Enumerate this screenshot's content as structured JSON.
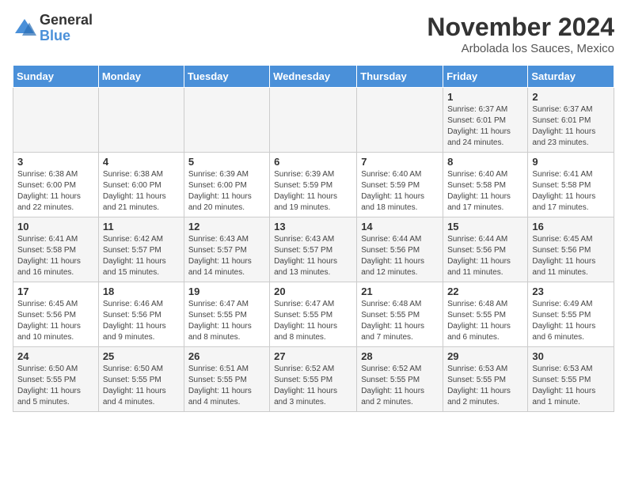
{
  "header": {
    "logo_general": "General",
    "logo_blue": "Blue",
    "month_title": "November 2024",
    "location": "Arbolada los Sauces, Mexico"
  },
  "calendar": {
    "days_of_week": [
      "Sunday",
      "Monday",
      "Tuesday",
      "Wednesday",
      "Thursday",
      "Friday",
      "Saturday"
    ],
    "weeks": [
      [
        {
          "day": "",
          "info": ""
        },
        {
          "day": "",
          "info": ""
        },
        {
          "day": "",
          "info": ""
        },
        {
          "day": "",
          "info": ""
        },
        {
          "day": "",
          "info": ""
        },
        {
          "day": "1",
          "info": "Sunrise: 6:37 AM\nSunset: 6:01 PM\nDaylight: 11 hours and 24 minutes."
        },
        {
          "day": "2",
          "info": "Sunrise: 6:37 AM\nSunset: 6:01 PM\nDaylight: 11 hours and 23 minutes."
        }
      ],
      [
        {
          "day": "3",
          "info": "Sunrise: 6:38 AM\nSunset: 6:00 PM\nDaylight: 11 hours and 22 minutes."
        },
        {
          "day": "4",
          "info": "Sunrise: 6:38 AM\nSunset: 6:00 PM\nDaylight: 11 hours and 21 minutes."
        },
        {
          "day": "5",
          "info": "Sunrise: 6:39 AM\nSunset: 6:00 PM\nDaylight: 11 hours and 20 minutes."
        },
        {
          "day": "6",
          "info": "Sunrise: 6:39 AM\nSunset: 5:59 PM\nDaylight: 11 hours and 19 minutes."
        },
        {
          "day": "7",
          "info": "Sunrise: 6:40 AM\nSunset: 5:59 PM\nDaylight: 11 hours and 18 minutes."
        },
        {
          "day": "8",
          "info": "Sunrise: 6:40 AM\nSunset: 5:58 PM\nDaylight: 11 hours and 17 minutes."
        },
        {
          "day": "9",
          "info": "Sunrise: 6:41 AM\nSunset: 5:58 PM\nDaylight: 11 hours and 17 minutes."
        }
      ],
      [
        {
          "day": "10",
          "info": "Sunrise: 6:41 AM\nSunset: 5:58 PM\nDaylight: 11 hours and 16 minutes."
        },
        {
          "day": "11",
          "info": "Sunrise: 6:42 AM\nSunset: 5:57 PM\nDaylight: 11 hours and 15 minutes."
        },
        {
          "day": "12",
          "info": "Sunrise: 6:43 AM\nSunset: 5:57 PM\nDaylight: 11 hours and 14 minutes."
        },
        {
          "day": "13",
          "info": "Sunrise: 6:43 AM\nSunset: 5:57 PM\nDaylight: 11 hours and 13 minutes."
        },
        {
          "day": "14",
          "info": "Sunrise: 6:44 AM\nSunset: 5:56 PM\nDaylight: 11 hours and 12 minutes."
        },
        {
          "day": "15",
          "info": "Sunrise: 6:44 AM\nSunset: 5:56 PM\nDaylight: 11 hours and 11 minutes."
        },
        {
          "day": "16",
          "info": "Sunrise: 6:45 AM\nSunset: 5:56 PM\nDaylight: 11 hours and 11 minutes."
        }
      ],
      [
        {
          "day": "17",
          "info": "Sunrise: 6:45 AM\nSunset: 5:56 PM\nDaylight: 11 hours and 10 minutes."
        },
        {
          "day": "18",
          "info": "Sunrise: 6:46 AM\nSunset: 5:56 PM\nDaylight: 11 hours and 9 minutes."
        },
        {
          "day": "19",
          "info": "Sunrise: 6:47 AM\nSunset: 5:55 PM\nDaylight: 11 hours and 8 minutes."
        },
        {
          "day": "20",
          "info": "Sunrise: 6:47 AM\nSunset: 5:55 PM\nDaylight: 11 hours and 8 minutes."
        },
        {
          "day": "21",
          "info": "Sunrise: 6:48 AM\nSunset: 5:55 PM\nDaylight: 11 hours and 7 minutes."
        },
        {
          "day": "22",
          "info": "Sunrise: 6:48 AM\nSunset: 5:55 PM\nDaylight: 11 hours and 6 minutes."
        },
        {
          "day": "23",
          "info": "Sunrise: 6:49 AM\nSunset: 5:55 PM\nDaylight: 11 hours and 6 minutes."
        }
      ],
      [
        {
          "day": "24",
          "info": "Sunrise: 6:50 AM\nSunset: 5:55 PM\nDaylight: 11 hours and 5 minutes."
        },
        {
          "day": "25",
          "info": "Sunrise: 6:50 AM\nSunset: 5:55 PM\nDaylight: 11 hours and 4 minutes."
        },
        {
          "day": "26",
          "info": "Sunrise: 6:51 AM\nSunset: 5:55 PM\nDaylight: 11 hours and 4 minutes."
        },
        {
          "day": "27",
          "info": "Sunrise: 6:52 AM\nSunset: 5:55 PM\nDaylight: 11 hours and 3 minutes."
        },
        {
          "day": "28",
          "info": "Sunrise: 6:52 AM\nSunset: 5:55 PM\nDaylight: 11 hours and 2 minutes."
        },
        {
          "day": "29",
          "info": "Sunrise: 6:53 AM\nSunset: 5:55 PM\nDaylight: 11 hours and 2 minutes."
        },
        {
          "day": "30",
          "info": "Sunrise: 6:53 AM\nSunset: 5:55 PM\nDaylight: 11 hours and 1 minute."
        }
      ]
    ]
  }
}
